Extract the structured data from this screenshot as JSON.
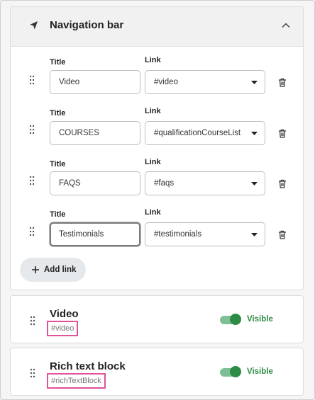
{
  "nav_bar": {
    "title": "Navigation bar",
    "links": [
      {
        "title_label": "Title",
        "link_label": "Link",
        "title_value": "Video",
        "link_value": "#video"
      },
      {
        "title_label": "Title",
        "link_label": "Link",
        "title_value": "COURSES",
        "link_value": "#qualificationCourseList"
      },
      {
        "title_label": "Title",
        "link_label": "Link",
        "title_value": "FAQS",
        "link_value": "#faqs"
      },
      {
        "title_label": "Title",
        "link_label": "Link",
        "title_value": "Testimonials",
        "link_value": "#testimonials"
      }
    ],
    "add_link_label": "Add link"
  },
  "sections": [
    {
      "title": "Video",
      "anchor": "#video",
      "visibility_label": "Visible",
      "visible": true
    },
    {
      "title": "Rich text block",
      "anchor": "#richTextBlock",
      "visibility_label": "Visible",
      "visible": true
    }
  ],
  "colors": {
    "accent_green": "#2e8b45",
    "highlight_pink": "#e0529a"
  }
}
